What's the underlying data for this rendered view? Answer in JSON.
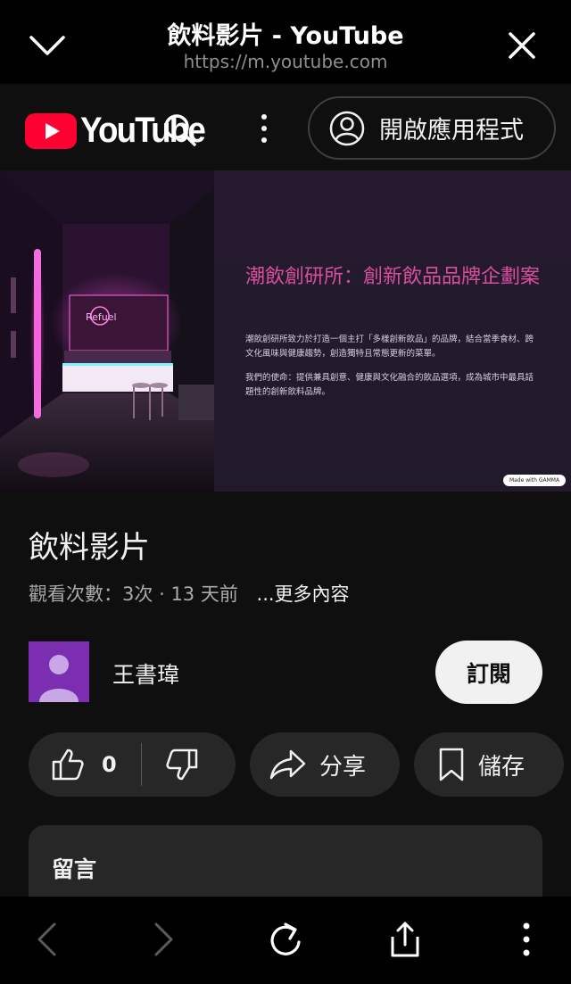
{
  "browser": {
    "title": "飲料影片 - YouTube",
    "url": "https://m.youtube.com"
  },
  "youtube": {
    "logo_text": "YouTube",
    "open_app_label": "開啟應用程式"
  },
  "video": {
    "slide_title": "潮飲創研所：創新飲品品牌企劃案",
    "slide_paragraph_1": "潮飲創研所致力於打造一個主打「多樣創新飲品」的品牌，結合當季食材、跨文化風味與健康趨勢，創造獨特且常態更新的菜單。",
    "slide_paragraph_2": "我們的使命：提供兼具創意、健康與文化融合的飲品選項，成為城市中最具話題性的創新飲料品牌。",
    "made_with": "Made with GAMMA",
    "title": "飲料影片",
    "views": "觀看次數：3次",
    "separator": "·",
    "time_ago": "13 天前",
    "more": "...更多內容"
  },
  "channel": {
    "name": "王書瑋",
    "subscribe_label": "訂閱"
  },
  "actions": {
    "like_count": "0",
    "share_label": "分享",
    "save_label": "儲存"
  },
  "comments": {
    "title": "留言"
  },
  "colors": {
    "yt_red": "#ff0033",
    "avatar_bg": "#7b2fb0",
    "slide_title": "#d94f9e"
  }
}
